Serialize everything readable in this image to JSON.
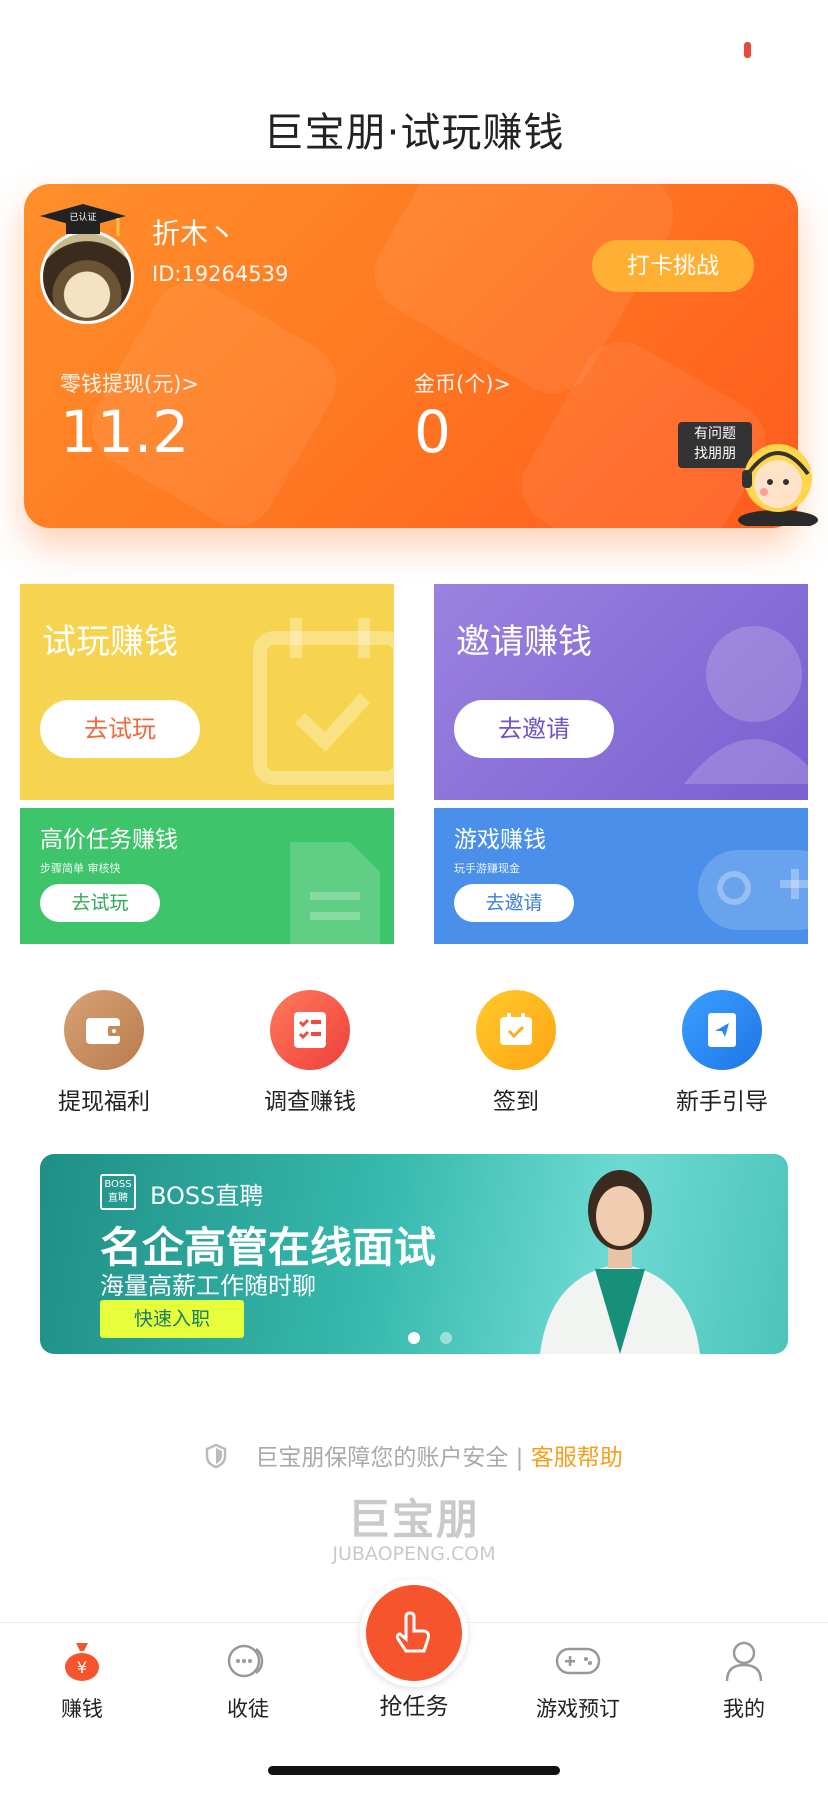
{
  "header": {
    "title": "巨宝朋·试玩赚钱"
  },
  "profile": {
    "avatar_badge": "已认证",
    "nickname": "折木丶",
    "user_id": "ID:19264539",
    "checkin_label": "打卡挑战",
    "balance_label": "零钱提现(元)>",
    "balance_value": "11.2",
    "coins_label": "金币(个)>",
    "coins_value": "0",
    "help_line1": "有问题",
    "help_line2": "找朋朋"
  },
  "tiles": {
    "trial": {
      "title": "试玩赚钱",
      "button": "去试玩",
      "color": "#f7d44f"
    },
    "invite": {
      "title": "邀请赚钱",
      "button": "去邀请",
      "color": "#8a6fd6"
    },
    "high_task": {
      "title": "高价任务赚钱",
      "subtitle": "步骤简单 审核快",
      "button": "去试玩",
      "color": "#3ec46a"
    },
    "game": {
      "title": "游戏赚钱",
      "subtitle": "玩手游赚现金",
      "button": "去邀请",
      "color": "#4a8fea"
    }
  },
  "menu": [
    {
      "label": "提现福利",
      "icon": "wallet-icon",
      "color": "#c98e5e"
    },
    {
      "label": "调查赚钱",
      "icon": "checklist-icon",
      "color": "#f25a4c"
    },
    {
      "label": "签到",
      "icon": "calendar-icon",
      "color": "#ffb31a"
    },
    {
      "label": "新手引导",
      "icon": "guide-book-icon",
      "color": "#2f8bf0"
    }
  ],
  "banner": {
    "brand_badge_top": "BOSS",
    "brand_badge_bottom": "直聘",
    "brand": "BOSS直聘",
    "headline": "名企高管在线面试",
    "subline": "海量高薪工作随时聊",
    "cta": "快速入职",
    "page": 1,
    "pages": 2
  },
  "footer": {
    "security_text": "巨宝朋保障您的账户安全",
    "separator": "|",
    "help_link": "客服帮助",
    "logo_text": "巨宝朋",
    "logo_url": "JUBAOPENG.COM"
  },
  "tabs": [
    {
      "label": "赚钱",
      "icon": "money-bag-icon",
      "active": true
    },
    {
      "label": "收徒",
      "icon": "apprentice-icon",
      "active": false
    },
    {
      "label": "抢任务",
      "icon": "hand-tap-icon",
      "active": false
    },
    {
      "label": "游戏预订",
      "icon": "gamepad-icon",
      "active": false
    },
    {
      "label": "我的",
      "icon": "person-icon",
      "active": false
    }
  ],
  "colors": {
    "accent": "#ff6a24",
    "active_tab": "#f5542c"
  }
}
